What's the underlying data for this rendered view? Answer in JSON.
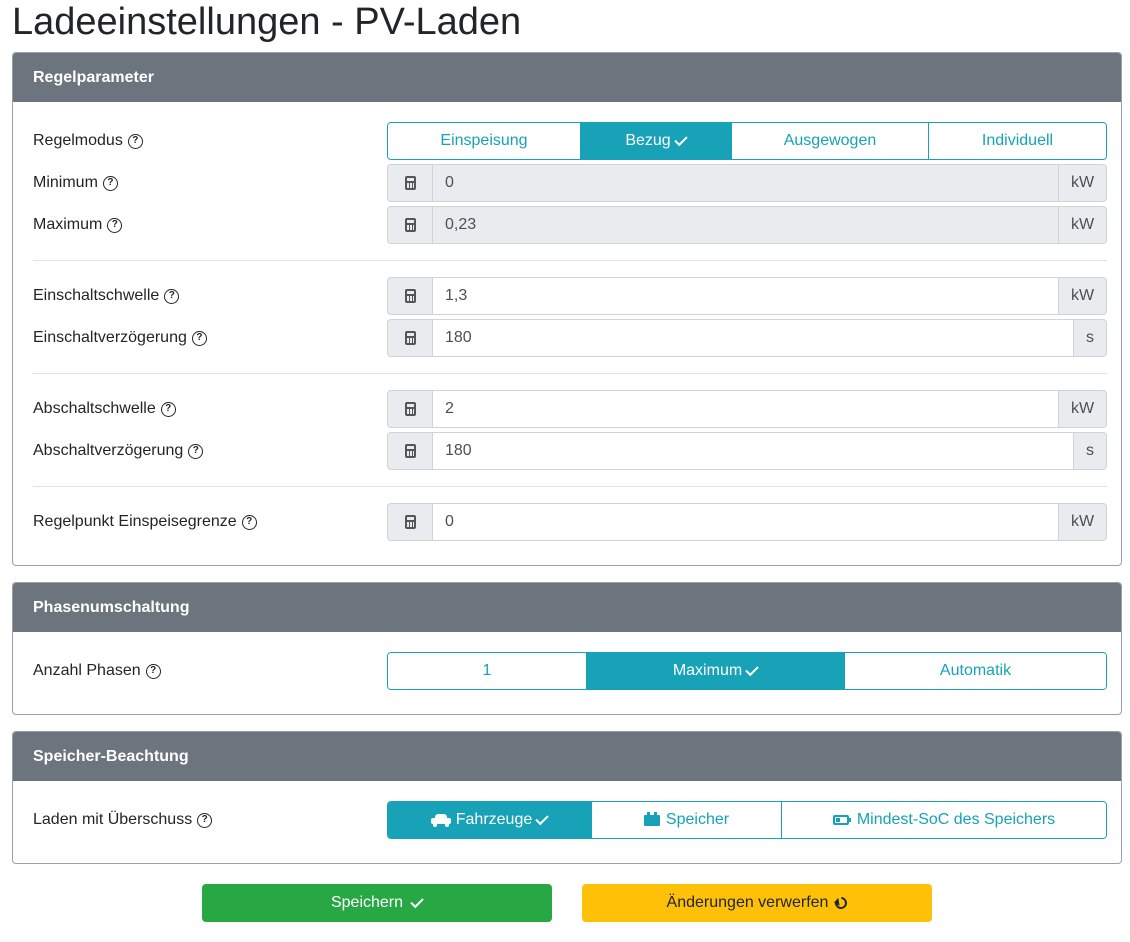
{
  "page": {
    "title": "Ladeeinstellungen - PV-Laden"
  },
  "regelparameter": {
    "header": "Regelparameter",
    "regelmodus": {
      "label": "Regelmodus",
      "options": [
        "Einspeisung",
        "Bezug",
        "Ausgewogen",
        "Individuell"
      ],
      "selected": "Bezug"
    },
    "minimum": {
      "label": "Minimum",
      "value": "0",
      "unit": "kW"
    },
    "maximum": {
      "label": "Maximum",
      "value": "0,23",
      "unit": "kW"
    },
    "einschaltschwelle": {
      "label": "Einschaltschwelle",
      "value": "1,3",
      "unit": "kW"
    },
    "einschaltverzoegerung": {
      "label": "Einschaltverzögerung",
      "value": "180",
      "unit": "s"
    },
    "abschaltschwelle": {
      "label": "Abschaltschwelle",
      "value": "2",
      "unit": "kW"
    },
    "abschaltverzoegerung": {
      "label": "Abschaltverzögerung",
      "value": "180",
      "unit": "s"
    },
    "regelpunkt": {
      "label": "Regelpunkt Einspeisegrenze",
      "value": "0",
      "unit": "kW"
    }
  },
  "phasenumschaltung": {
    "header": "Phasenumschaltung",
    "anzahl_phasen": {
      "label": "Anzahl Phasen",
      "options": [
        "1",
        "Maximum",
        "Automatik"
      ],
      "selected": "Maximum"
    }
  },
  "speicher": {
    "header": "Speicher-Beachtung",
    "laden": {
      "label": "Laden mit Überschuss",
      "options": [
        "Fahrzeuge",
        "Speicher",
        "Mindest-SoC des Speichers"
      ],
      "selected": "Fahrzeuge",
      "icons": [
        "car-icon",
        "battery-icon",
        "battery-low-icon"
      ]
    }
  },
  "actions": {
    "save_label": "Speichern",
    "discard_label": "Änderungen verwerfen"
  },
  "colors": {
    "header_bg": "#6c757d",
    "accent": "#17a2b8",
    "save": "#28a745",
    "discard": "#ffc107"
  }
}
